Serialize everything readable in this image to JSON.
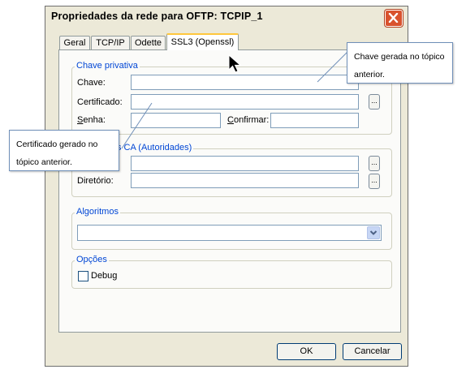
{
  "window": {
    "title": "Propriedades da rede para OFTP: TCPIP_1"
  },
  "tabs": [
    {
      "label": "Geral",
      "active": false
    },
    {
      "label": "TCP/IP",
      "active": false
    },
    {
      "label": "Odette",
      "active": false
    },
    {
      "label": "SSL3 (Openssl)",
      "active": true
    }
  ],
  "private_key_group": {
    "legend": "Chave privativa",
    "key_label": "Chave:",
    "key_value": "",
    "certificate_label": "Certificado:",
    "certificate_value": "",
    "password_label_u": "S",
    "password_label_rest": "enha:",
    "password_value": "",
    "confirm_label_u": "C",
    "confirm_label_rest": "onfirmar:",
    "confirm_value": "",
    "browse_label": "..."
  },
  "ca_group": {
    "legend": "s CA (Autoridades)",
    "file_value": "",
    "directory_label": "Diretório:",
    "directory_value": "",
    "browse_label": "..."
  },
  "algorithms_group": {
    "legend": "Algoritmos",
    "selected_value": ""
  },
  "options_group": {
    "legend": "Opções",
    "debug_label": "Debug",
    "debug_checked": false
  },
  "buttons": {
    "ok": "OK",
    "cancel": "Cancelar"
  },
  "callouts": {
    "top_right": "Chave gerada no tópico anterior.",
    "left": "Certificado gerado no tópico anterior."
  },
  "colors": {
    "accent_legend": "#0046d5",
    "tab_highlight": "#ffc73c",
    "close_button": "#d9522e"
  },
  "icons": [
    "close-icon",
    "chevron-down-icon",
    "mouse-pointer-icon"
  ]
}
